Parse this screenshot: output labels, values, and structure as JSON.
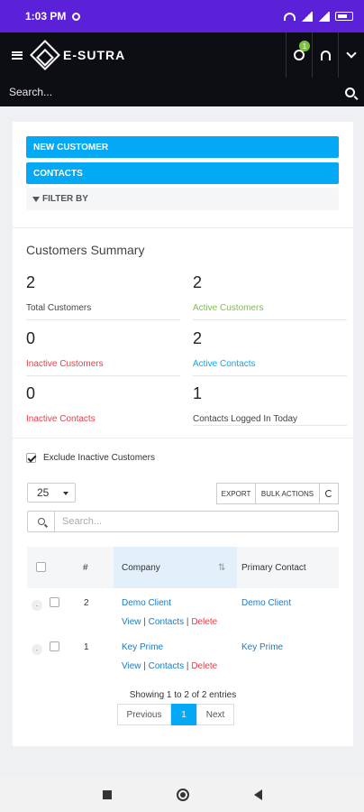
{
  "status_bar": {
    "time": "1:03 PM"
  },
  "header": {
    "brand": "E-SUTRA",
    "timer_badge": "1"
  },
  "search": {
    "placeholder": "Search..."
  },
  "actions": {
    "new_customer": "NEW CUSTOMER",
    "contacts": "CONTACTS",
    "filter_by": "FILTER BY"
  },
  "summary": {
    "title": "Customers Summary",
    "stats": [
      {
        "value": "2",
        "label": "Total Customers"
      },
      {
        "value": "2",
        "label": "Active Customers"
      },
      {
        "value": "0",
        "label": "Inactive Customers"
      },
      {
        "value": "2",
        "label": "Active Contacts"
      },
      {
        "value": "0",
        "label": "Inactive Contacts"
      },
      {
        "value": "1",
        "label": "Contacts Logged In Today"
      }
    ]
  },
  "colors": {
    "accent": "#03a9f4",
    "green": "#7cc242",
    "red": "#e8404a",
    "statusbar": "#5b21d8"
  },
  "table_controls": {
    "exclude_inactive": "Exclude Inactive Customers",
    "page_size": "25",
    "export": "EXPORT",
    "bulk_actions": "BULK ACTIONS",
    "search_placeholder": "Search..."
  },
  "table": {
    "headers": {
      "number": "#",
      "company": "Company",
      "primary_contact": "Primary Contact"
    },
    "rows": [
      {
        "number": "2",
        "company": "Demo Client",
        "primary_contact": "Demo Client",
        "view": "View",
        "contacts": "Contacts",
        "delete": "Delete"
      },
      {
        "number": "1",
        "company": "Key Prime",
        "primary_contact": "Key Prime",
        "view": "View",
        "contacts": "Contacts",
        "delete": "Delete"
      }
    ]
  },
  "pagination": {
    "info": "Showing 1 to 2 of 2 entries",
    "previous": "Previous",
    "current": "1",
    "next": "Next"
  }
}
